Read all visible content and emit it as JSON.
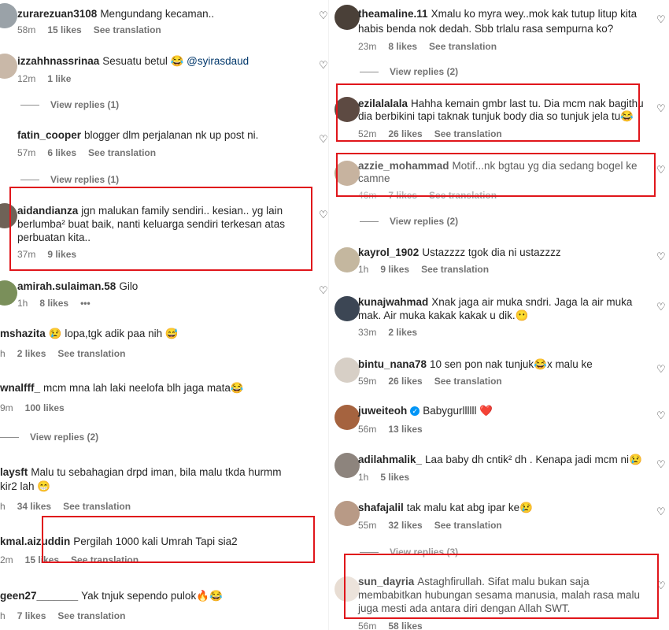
{
  "left": {
    "comments": [
      {
        "user": "zurarezuan3108",
        "text": "Mengundang kecaman..",
        "time": "58m",
        "likes": "15 likes",
        "translate": "See translation"
      },
      {
        "user": "izzahhnassrinaa",
        "text": "Sesuatu betul 😂 ",
        "mention": "@syirasdaud",
        "time": "12m",
        "likes": "1 like"
      },
      {
        "replies": "View replies (1)"
      },
      {
        "user": "fatin_cooper",
        "text": "blogger dlm perjalanan nk up post ni.",
        "time": "57m",
        "likes": "6 likes",
        "translate": "See translation"
      },
      {
        "replies": "View replies (1)"
      },
      {
        "user": "aidandianza",
        "text": "jgn malukan family sendiri.. kesian.. yg lain",
        "line2": "berlumba² buat baik, nanti keluarga sendiri terkesan atas",
        "line3": "perbuatan kita..",
        "time": "37m",
        "likes": "9 likes"
      },
      {
        "user": "amirah.sulaiman.58",
        "text": "Gilo",
        "time": "1h",
        "likes": "8 likes",
        "more": "•••"
      },
      {
        "user": "mshazita",
        "text": "😢 lopa,tgk adik paa nih 😅",
        "time": "h",
        "likes": "2 likes",
        "translate": "See translation"
      },
      {
        "user": "wnalfff_",
        "text": "mcm mna lah laki neelofa blh jaga mata😂",
        "time": "9m",
        "likes": "100 likes"
      },
      {
        "replies": "View replies (2)"
      },
      {
        "user": "laysft",
        "text": "Malu tu sebahagian drpd iman, bila malu tkda hurmm",
        "line2": "kir2 lah 😁",
        "time": "h",
        "likes": "34 likes",
        "translate": "See translation"
      },
      {
        "user": "kmal.aizuddin",
        "text": "Pergilah 1000 kali Umrah Tapi sia2",
        "time": "2m",
        "likes": "15 likes",
        "translate": "See translation"
      },
      {
        "user": "geen27_______",
        "text": "Yak tnjuk sependo pulok🔥😂",
        "time": "h",
        "likes": "7 likes",
        "translate": "See translation"
      }
    ]
  },
  "right": {
    "comments": [
      {
        "user": "theamaline.11",
        "text": "Xmalu ko myra wey..mok kak tutup litup kita",
        "line2": "habis benda nok dedah. Sbb trlalu rasa sempurna ko?",
        "time": "23m",
        "likes": "8 likes",
        "translate": "See translation"
      },
      {
        "replies": "View replies (2)"
      },
      {
        "user": "ezilalalala",
        "text": "Hahha kemain gmbr last tu. Dia mcm nak bagithu",
        "line2": "dia berbikini tapi taknak tunjuk body dia so tunjuk jela tu😂",
        "time": "52m",
        "likes": "26 likes",
        "translate": "See translation"
      },
      {
        "user": "azzie_mohammad",
        "text": "Motif...nk bgtau yg dia sedang bogel ke",
        "line2": "camne",
        "time": "46m",
        "likes": "7 likes",
        "translate": "See translation"
      },
      {
        "replies": "View replies (2)"
      },
      {
        "user": "kayrol_1902",
        "text": "Ustazzzz tgok dia ni ustazzzz",
        "time": "1h",
        "likes": "9 likes",
        "translate": "See translation"
      },
      {
        "user": "kunajwahmad",
        "text": "Xnak jaga air muka sndri. Jaga la air muka",
        "line2": "mak. Air muka kakak kakak u dik.😶",
        "time": "33m",
        "likes": "2 likes"
      },
      {
        "user": "bintu_nana78",
        "text": "10 sen pon nak tunjuk😂x malu ke",
        "time": "59m",
        "likes": "26 likes",
        "translate": "See translation"
      },
      {
        "user": "juweiteoh",
        "text": "Babygurllllll ❤️",
        "time": "56m",
        "likes": "13 likes",
        "verified": "✓"
      },
      {
        "user": "adilahmalik_",
        "text": "Laa baby dh cntik² dh . Kenapa jadi mcm ni😢",
        "time": "1h",
        "likes": "5 likes"
      },
      {
        "user": "shafajalil",
        "text": "tak malu kat abg ipar ke😢",
        "time": "55m",
        "likes": "32 likes",
        "translate": "See translation"
      },
      {
        "replies": "View replies (3)"
      },
      {
        "user": "sun_dayria",
        "text": "Astaghfirullah. Sifat malu bukan saja",
        "line2": "membabitkan hubungan sesama manusia, malah rasa malu",
        "line3": "juga mesti ada antara diri dengan Allah SWT.",
        "time": "56m",
        "likes": "58 likes"
      }
    ]
  },
  "colors": {
    "highlight": "#e0161b",
    "meta": "#737373",
    "mention": "#00376b",
    "verified": "#0095f6"
  },
  "icons": {
    "like": "heart-outline-icon",
    "more": "more-horizontal-icon"
  }
}
